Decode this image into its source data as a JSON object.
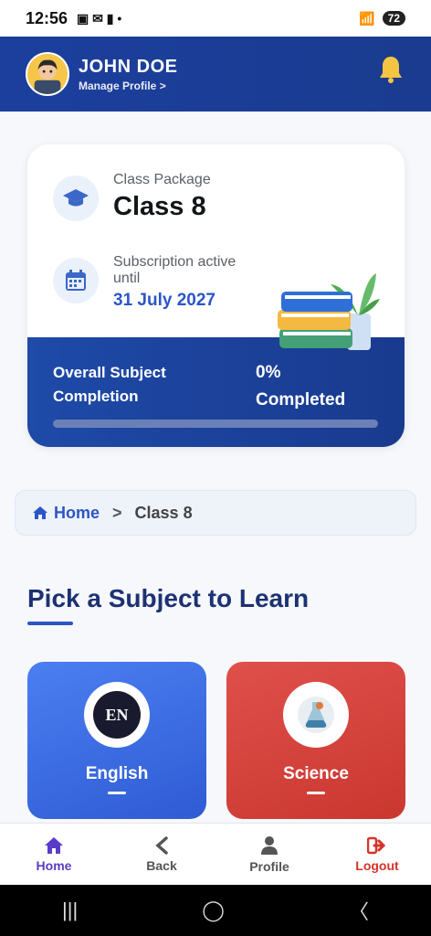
{
  "status": {
    "time": "12:56",
    "battery": "72"
  },
  "header": {
    "name": "JOHN DOE",
    "subtitle": "Manage Profile >"
  },
  "card": {
    "package_label": "Class Package",
    "package_value": "Class 8",
    "sub_label": "Subscription active until",
    "sub_date": "31 July 2027",
    "progress_label": "Overall Subject Completion",
    "progress_pct": "0%",
    "progress_word": "Completed",
    "progress_value": 0
  },
  "breadcrumb": {
    "home": "Home",
    "separator": ">",
    "current": "Class 8"
  },
  "section": {
    "title": "Pick a Subject to Learn"
  },
  "subjects": [
    {
      "name": "English",
      "icon": "EN",
      "color": "#3a67e0"
    },
    {
      "name": "Science",
      "icon": "flask-icon",
      "color": "#d9453e"
    }
  ],
  "nav": [
    {
      "label": "Home",
      "icon": "home-icon"
    },
    {
      "label": "Back",
      "icon": "chevron-left-icon"
    },
    {
      "label": "Profile",
      "icon": "user-icon"
    },
    {
      "label": "Logout",
      "icon": "logout-icon"
    }
  ],
  "colors": {
    "header": "#1c3f9e",
    "accent": "#2b56c6",
    "title": "#1d3273"
  }
}
